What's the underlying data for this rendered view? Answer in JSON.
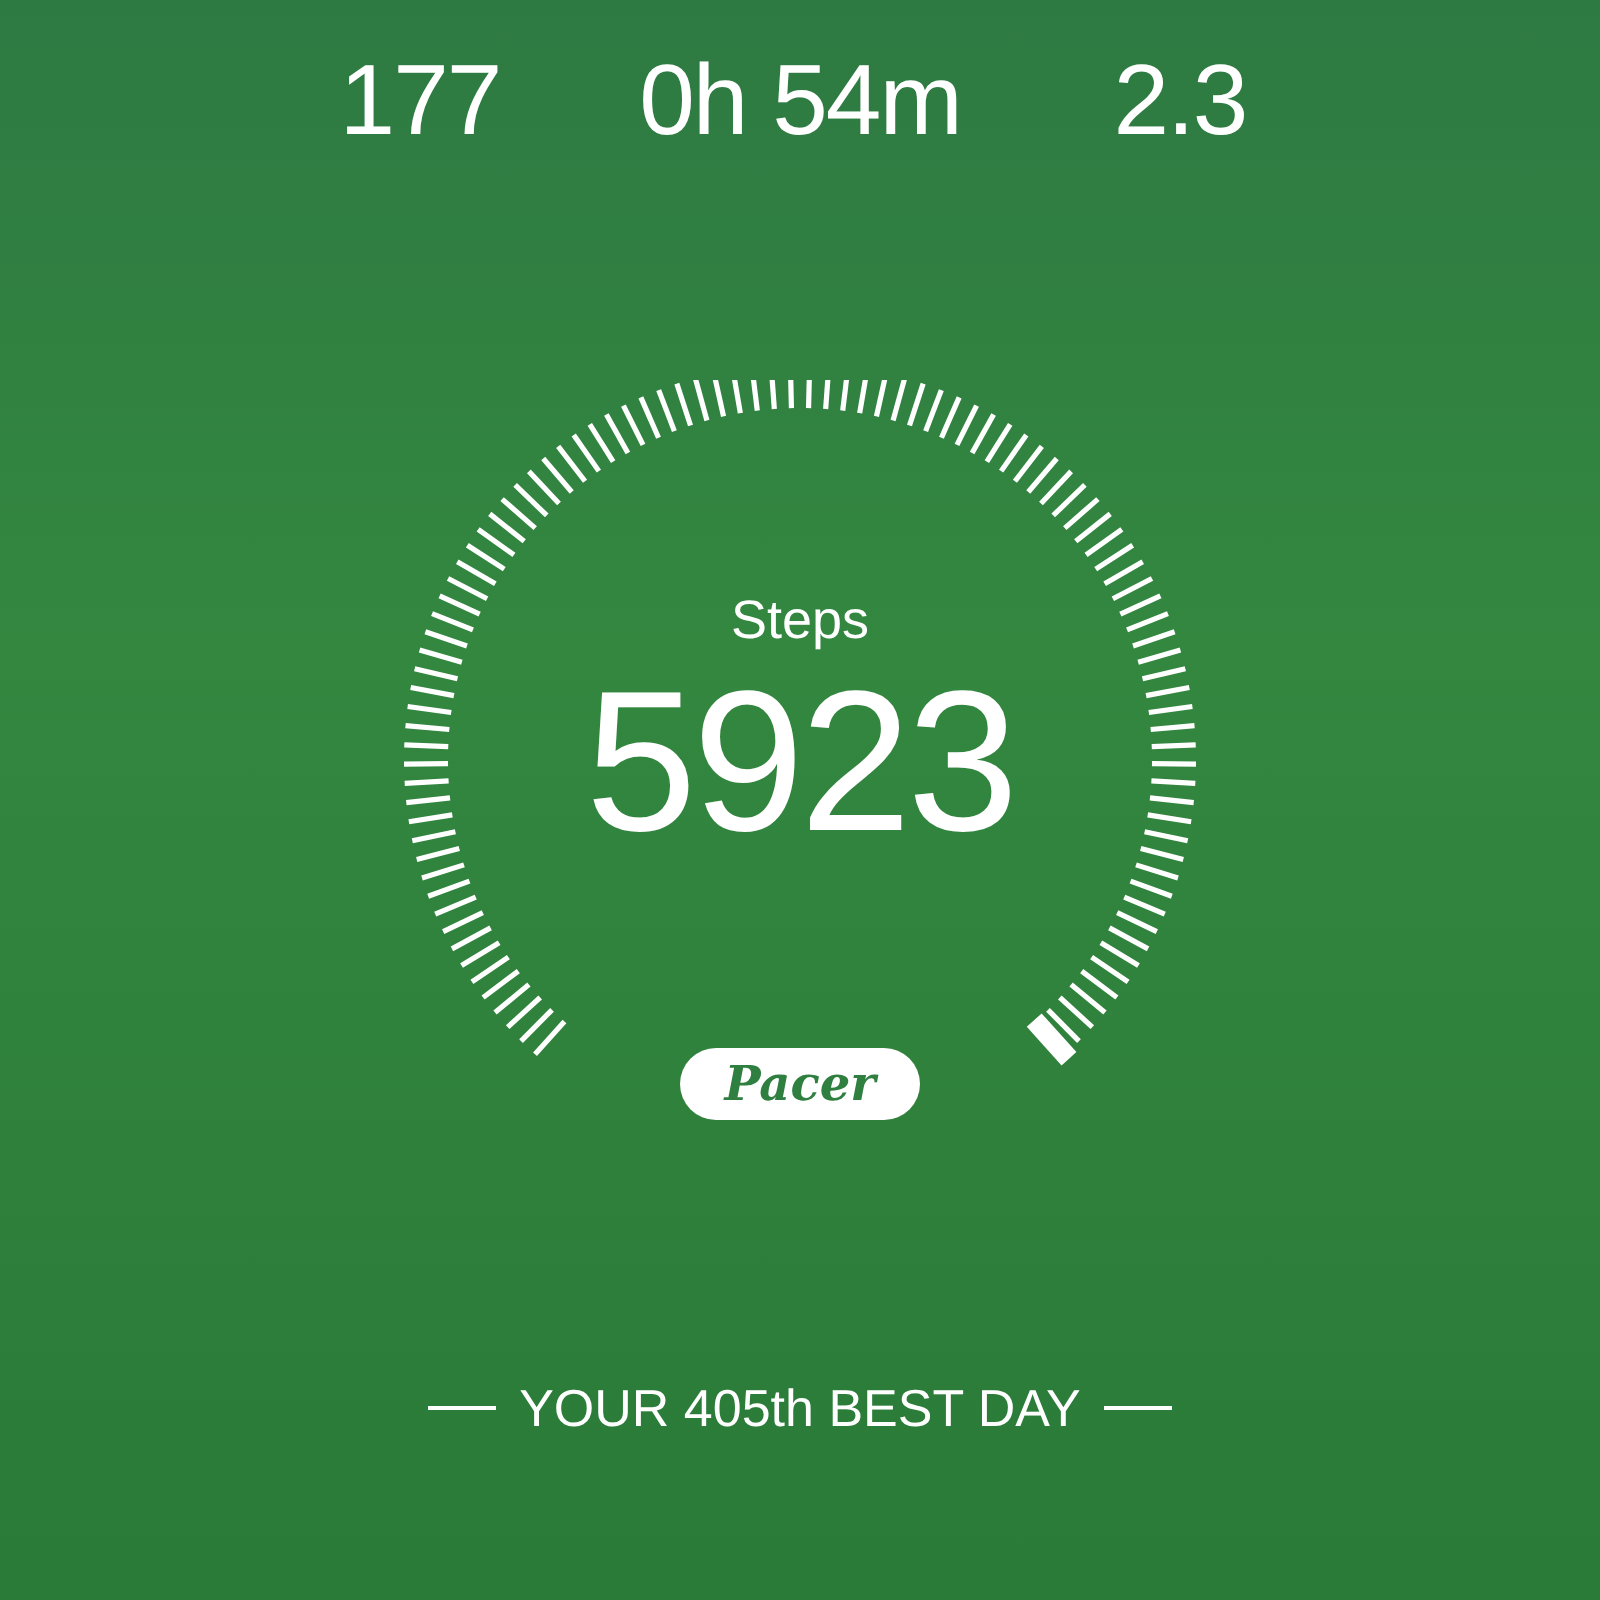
{
  "stats": [
    {
      "value": "177"
    },
    {
      "value": "0h 54m"
    },
    {
      "value": "2.3"
    }
  ],
  "gauge": {
    "label": "Steps",
    "value": "5923"
  },
  "logo": "Pacer",
  "rank": "YOUR 405th BEST DAY"
}
